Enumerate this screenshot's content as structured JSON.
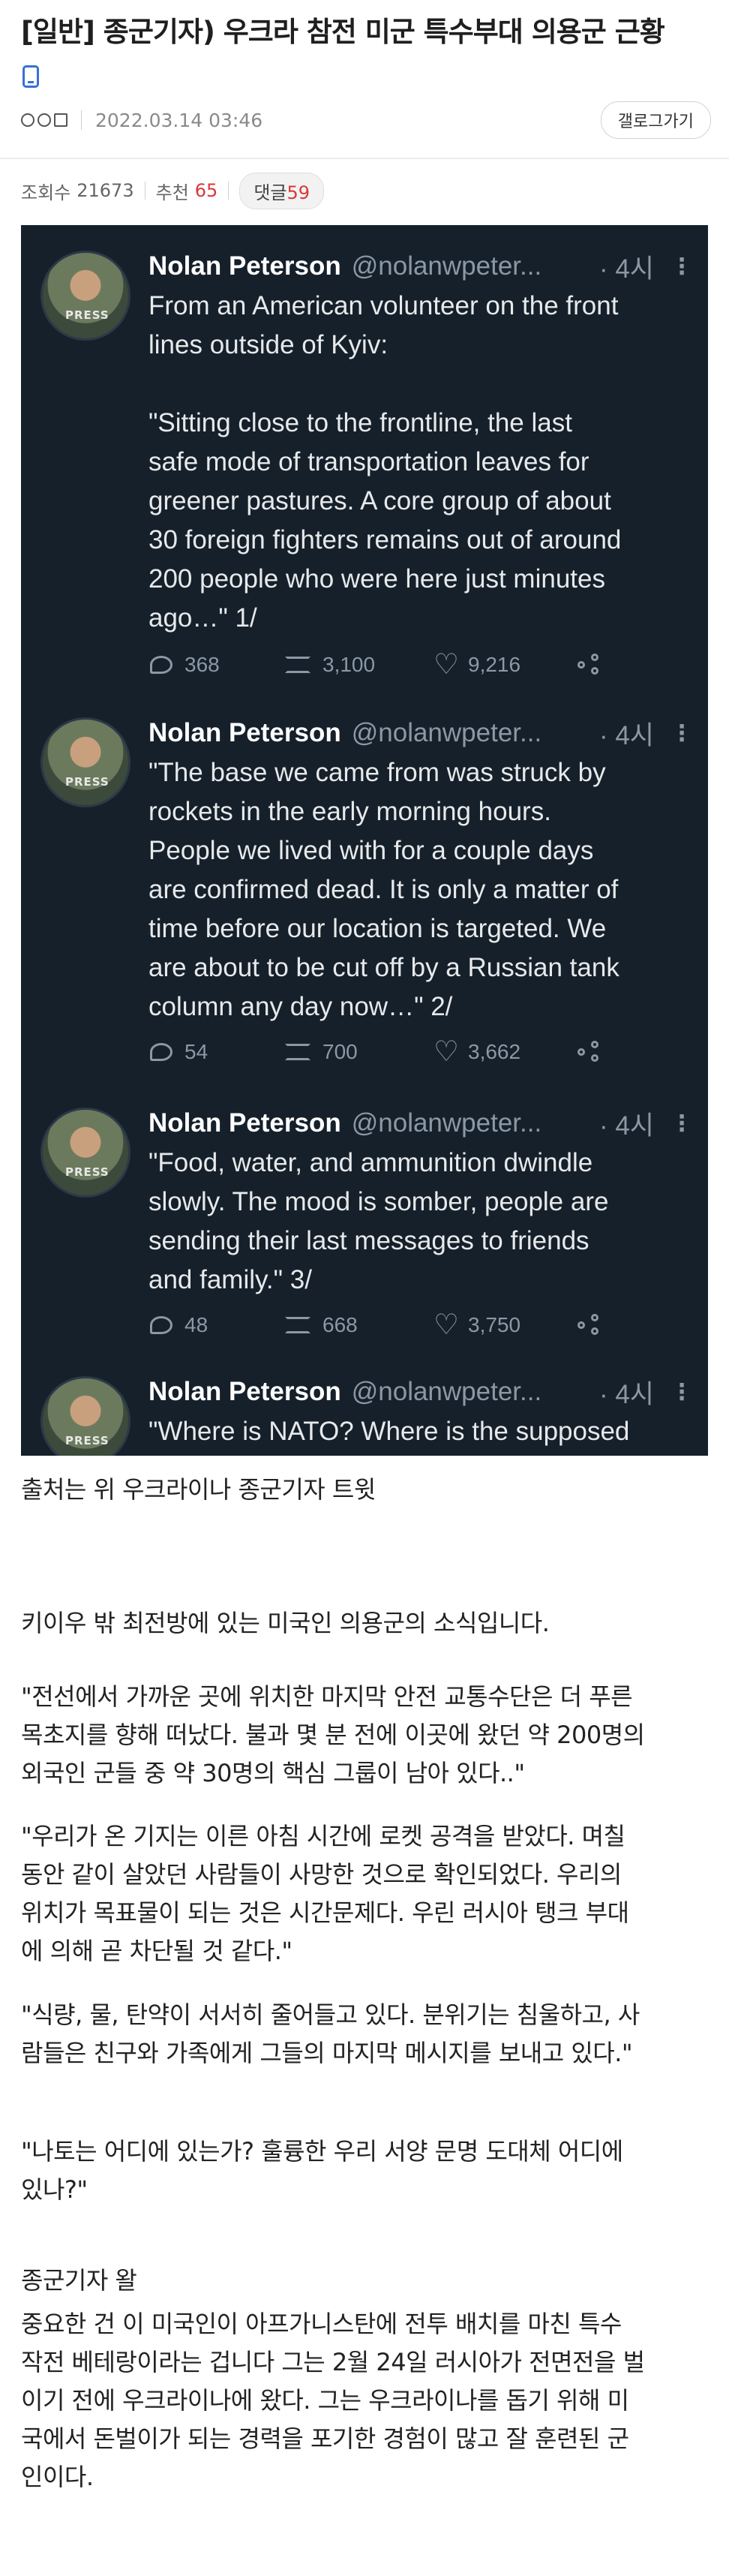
{
  "post": {
    "title": "[일반] 종군기자) 우크라 참전 미군 특수부대 의용군 근황",
    "author_nick": "ㅇㅇ",
    "date": "2022.03.14 03:46",
    "gallery_button": "갤로그가기",
    "views_label": "조회수",
    "views": "21673",
    "recommend_label": "추천",
    "recommend": "65",
    "comments_label": "댓글",
    "comments": "59"
  },
  "tweets": [
    {
      "name": "Nolan Peterson",
      "handle": "@nolanwpeter...",
      "time": "· 4시",
      "text": "From an American volunteer on the front\nlines outside of Kyiv:\n\n\"Sitting close to the frontline, the last\nsafe mode of transportation leaves for\ngreener pastures. A core group of about\n30 foreign fighters remains out of around\n200 people who were here just minutes\nago…\" 1/",
      "replies": "368",
      "retweets": "3,100",
      "likes": "9,216"
    },
    {
      "name": "Nolan Peterson",
      "handle": "@nolanwpeter...",
      "time": "· 4시",
      "text": "\"The base we came from was struck by\nrockets in the early morning hours.\nPeople we lived with for a couple days\nare confirmed dead. It is only a matter of\ntime before our location is targeted. We\nare about to be cut off by a Russian tank\ncolumn any day now…\" 2/",
      "replies": "54",
      "retweets": "700",
      "likes": "3,662"
    },
    {
      "name": "Nolan Peterson",
      "handle": "@nolanwpeter...",
      "time": "· 4시",
      "text": "\"Food, water, and ammunition dwindle\nslowly. The mood is somber, people are\nsending their last messages to friends\nand family.\" 3/",
      "replies": "48",
      "retweets": "668",
      "likes": "3,750"
    },
    {
      "name": "Nolan Peterson",
      "handle": "@nolanwpeter...",
      "time": "· 4시",
      "text": "\"Where is NATO? Where is the supposed"
    }
  ],
  "article": {
    "source": "출처는 위 우크라이나 종군기자 트윗",
    "intro": "키이우 밖 최전방에 있는 미국인 의용군의 소식입니다.",
    "quote1": "\"전선에서 가까운 곳에 위치한 마지막 안전 교통수단은 더 푸른\n목초지를 향해 떠났다. 불과 몇 분 전에 이곳에 왔던 약 200명의\n외국인 군들 중 약 30명의 핵심 그룹이 남아 있다..\"",
    "quote2": "\"우리가 온 기지는 이른 아침 시간에 로켓 공격을 받았다. 며칠\n동안 같이 살았던 사람들이 사망한 것으로 확인되었다. 우리의\n위치가 목표물이 되는 것은 시간문제다. 우린 러시아 탱크 부대\n에 의해 곧 차단될 것 같다.\"",
    "quote3": "\"식량, 물, 탄약이 서서히 줄어들고 있다. 분위기는 침울하고, 사\n람들은 친구와 가족에게 그들의 마지막 메시지를 보내고 있다.\"",
    "quote4": "\"나토는 어디에 있는가? 훌륭한 우리 서양 문명 도대체 어디에\n있나?\"",
    "reporter_heading": "종군기자 왈",
    "reporter_text": "중요한 건 이 미국인이 아프가니스탄에 전투 배치를 마친 특수\n작전 베테랑이라는 겁니다 그는 2월 24일 러시아가 전면전을 벌\n이기 전에 우크라이나에 왔다. 그는 우크라이나를 돕기 위해 미\n국에서 돈벌이가 되는 경력을 포기한 경험이 많고 잘 훈련된 군\n인이다."
  },
  "colors": {
    "tweet_background": "#15202b",
    "tweet_text": "#e7e9ea",
    "tweet_muted": "#8b98a5",
    "recommend_red": "#d9383a"
  },
  "icons": [
    "phone-emoji-icon",
    "reply-icon",
    "retweet-icon",
    "like-icon",
    "share-icon",
    "more-icon"
  ]
}
